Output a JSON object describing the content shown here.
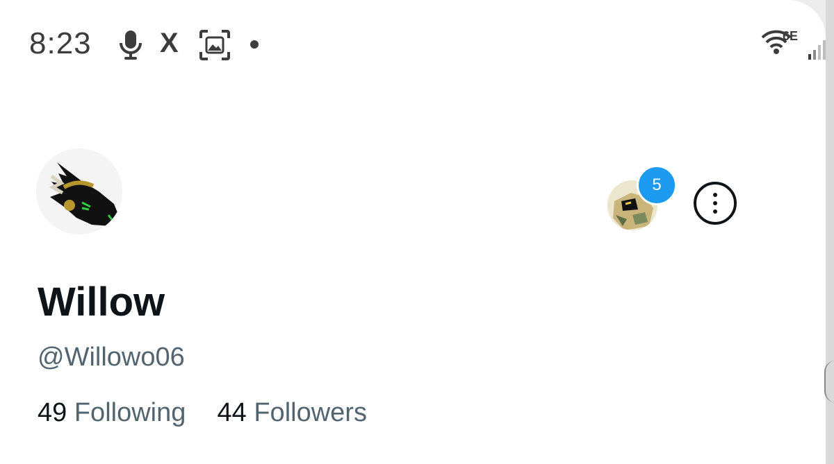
{
  "status_bar": {
    "time": "8:23",
    "icons": [
      "mic-icon",
      "x-logo-icon",
      "screenshot-icon",
      "notification-dot",
      "wifi-icon",
      "signal-icon"
    ],
    "x_glyph": "X",
    "network_label": "6E"
  },
  "profile": {
    "display_name": "Willow",
    "handle": "@Willowo06",
    "following_count": "49",
    "following_label": "Following",
    "followers_count": "44",
    "followers_label": "Followers"
  },
  "account_switcher": {
    "badge_count": "5"
  },
  "colors": {
    "accent": "#1d9bf0",
    "text_primary": "#0f1419",
    "text_secondary": "#536471",
    "status_text": "#3c3c3c"
  }
}
